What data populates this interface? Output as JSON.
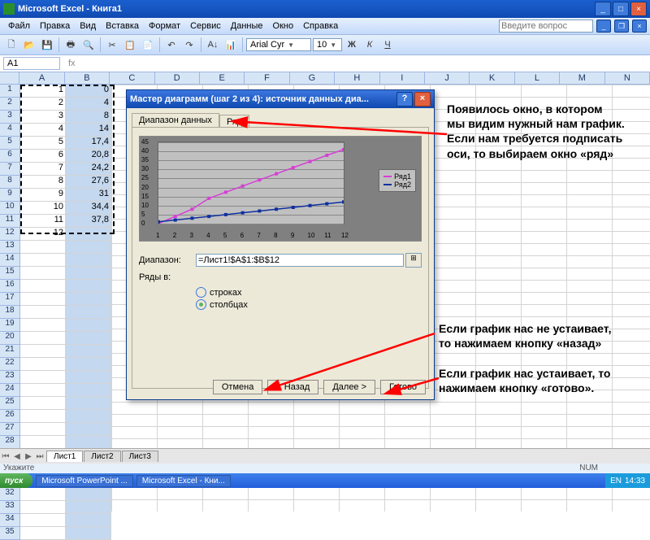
{
  "window": {
    "title": "Microsoft Excel - Книга1"
  },
  "menu": {
    "file": "Файл",
    "edit": "Правка",
    "view": "Вид",
    "insert": "Вставка",
    "format": "Формат",
    "tools": "Сервис",
    "data": "Данные",
    "window": "Окно",
    "help": "Справка",
    "ask": "Введите вопрос"
  },
  "font": {
    "name": "Arial Cyr",
    "size": "10"
  },
  "namebox": "A1",
  "columns": [
    "A",
    "B",
    "C",
    "D",
    "E",
    "F",
    "G",
    "H",
    "I",
    "J",
    "K",
    "L",
    "M",
    "N"
  ],
  "rowcount": 35,
  "colA": [
    "1",
    "2",
    "3",
    "4",
    "5",
    "6",
    "7",
    "8",
    "9",
    "10",
    "11",
    "12"
  ],
  "colB": [
    "0",
    "4",
    "8",
    "14",
    "17,4",
    "20,8",
    "24,2",
    "27,6",
    "31",
    "34,4",
    "37,8",
    ""
  ],
  "dialog": {
    "title": "Мастер диаграмм (шаг 2 из 4): источник данных диа...",
    "tab1": "Диапазон данных",
    "tab2": "Ряд",
    "range_label": "Диапазон:",
    "range_value": "=Лист1!$A$1:$B$12",
    "rows_in": "Ряды в:",
    "opt_rows": "строках",
    "opt_cols": "столбцах",
    "legend1": "Ряд1",
    "legend2": "Ряд2",
    "btn_cancel": "Отмена",
    "btn_back": "< Назад",
    "btn_next": "Далее >",
    "btn_finish": "Готово"
  },
  "sheets": {
    "s1": "Лист1",
    "s2": "Лист2",
    "s3": "Лист3"
  },
  "status": {
    "point": "Укажите",
    "num": "NUM"
  },
  "taskbar": {
    "start": "пуск",
    "pp": "Microsoft PowerPoint ...",
    "xl": "Microsoft Excel - Кни...",
    "lang": "EN",
    "time": "14:33"
  },
  "annotations": {
    "a1": "Появилось окно, в котором\nмы видим нужный нам график.\nЕсли нам требуется подписать\nоси, то выбираем окно «ряд»",
    "a2": "Если график нас не устаивает,\nто нажимаем кнопку «назад»",
    "a3": "Если график нас устаивает, то\nнажимаем  кнопку «готово»."
  },
  "chart_data": {
    "type": "line",
    "x": [
      1,
      2,
      3,
      4,
      5,
      6,
      7,
      8,
      9,
      10,
      11,
      12
    ],
    "series": [
      {
        "name": "Ряд1",
        "color": "#d63fd6",
        "values": [
          0,
          4,
          8,
          14,
          17.4,
          20.8,
          24.2,
          27.6,
          31,
          34.4,
          37.8,
          41
        ]
      },
      {
        "name": "Ряд2",
        "color": "#1030a0",
        "values": [
          1,
          2,
          3,
          4,
          5,
          6,
          7,
          8,
          9,
          10,
          11,
          12
        ]
      }
    ],
    "ylim": [
      0,
      45
    ],
    "yticks": [
      0,
      5,
      10,
      15,
      20,
      25,
      30,
      35,
      40,
      45
    ]
  }
}
